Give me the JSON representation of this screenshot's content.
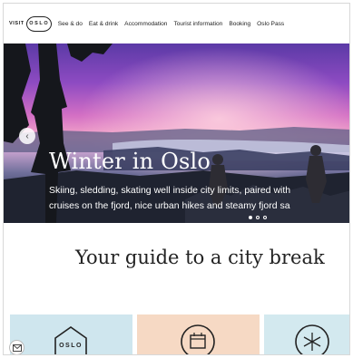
{
  "header": {
    "logo_visit": "VISIT",
    "logo_oslo": "OSLO",
    "nav": [
      {
        "label": "See & do"
      },
      {
        "label": "Eat & drink"
      },
      {
        "label": "Accommodation"
      },
      {
        "label": "Tourist information"
      },
      {
        "label": "Booking"
      },
      {
        "label": "Oslo Pass"
      }
    ]
  },
  "hero": {
    "title": "Winter in Oslo",
    "description_line1": "Skiing, sledding, skating well inside city limits, paired with",
    "description_line2": "cruises on the fjord, nice urban hikes and steamy fjord sa",
    "slides_total": 3,
    "active_slide": 1,
    "prev_icon": "chevron-left-icon"
  },
  "main": {
    "heading": "Your guide to a city break"
  },
  "cards": [
    {
      "icon": "oslo-pass-icon",
      "icon_text": "OSLO",
      "color": "#cfe6ee"
    },
    {
      "icon": "calendar-icon",
      "color": "#f6d9c4"
    },
    {
      "icon": "snowflake-icon",
      "color": "#d3e9ef"
    }
  ],
  "floating": {
    "icon": "mail-icon"
  }
}
